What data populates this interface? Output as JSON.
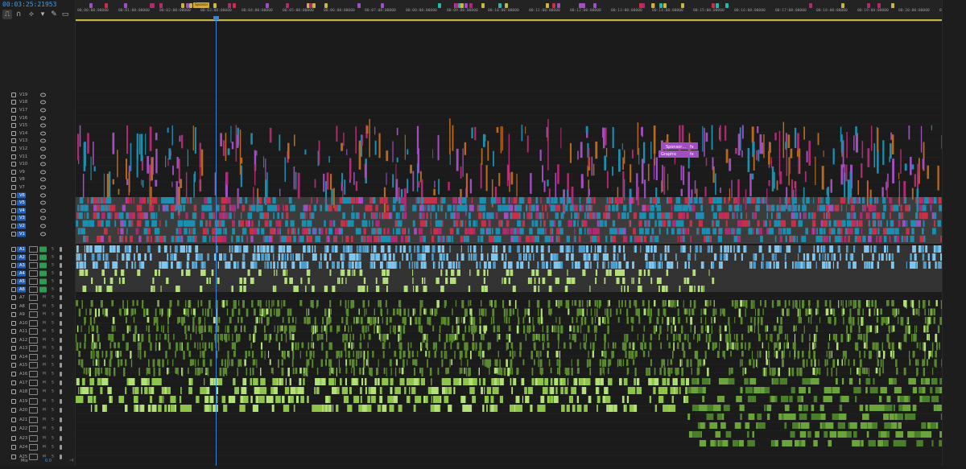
{
  "timecode": "00:03:25:21953",
  "tools": [
    "snap-icon",
    "link-icon",
    "marker-tool-icon",
    "marker-icon",
    "wrench-icon",
    "captions-icon"
  ],
  "ruler": {
    "ticks": [
      "00;00:00:00000",
      "00:01:00:00000",
      "00:02:00:00000",
      "00:03:00:00000",
      "00:04:00:00000",
      "00:05:00:00000",
      "00:06:00:00000",
      "00:07:00:00000",
      "00:08:00:00000",
      "00:09:00:00000",
      "00:10:00:00000",
      "00:11:00:00000",
      "00:12:00:00000",
      "00:13:00:00000",
      "00:14:00:00000",
      "00:15:00:00000",
      "00:16:00:00000",
      "00:17:00:00000",
      "00:18:00:00000",
      "00:19:00:00000",
      "00:20:00:00000",
      "00:21:00:00000"
    ],
    "marker_label": "Sponsor"
  },
  "video_tracks": [
    "V19",
    "V18",
    "V17",
    "V16",
    "V15",
    "V14",
    "V13",
    "V12",
    "V11",
    "V10",
    "V9",
    "V8",
    "V7",
    "V6",
    "V5",
    "V4",
    "V3",
    "V2",
    "V1"
  ],
  "active_video": [
    "V6",
    "V5",
    "V4",
    "V3",
    "V2",
    "V1"
  ],
  "audio_tracks": [
    "A1",
    "A2",
    "A3",
    "A4",
    "A5",
    "A6",
    "A7",
    "A8",
    "A9",
    "A10",
    "A11",
    "A12",
    "A13",
    "A14",
    "A15",
    "A16",
    "A17",
    "A18",
    "A19",
    "A20",
    "A21",
    "A22",
    "A23",
    "A24",
    "A25"
  ],
  "active_audio": [
    "A1",
    "A2",
    "A3",
    "A4",
    "A5",
    "A6"
  ],
  "clip_labels": {
    "sponsor": "Sponsor…",
    "graphic": "Graphic",
    "fx": "fx"
  },
  "mix": {
    "label": "Mix",
    "value": "0.0"
  },
  "colors": {
    "orange": "#b8681f",
    "purple": "#a04ec0",
    "magenta": "#b02a72",
    "teal": "#1b8fb0",
    "crimson": "#c8304a",
    "lightblue": "#7fc6ef",
    "lime": "#b4e07a",
    "green": "#5a8a2e",
    "yellow": "#c9b73c",
    "playhead": "#3a83d6"
  }
}
